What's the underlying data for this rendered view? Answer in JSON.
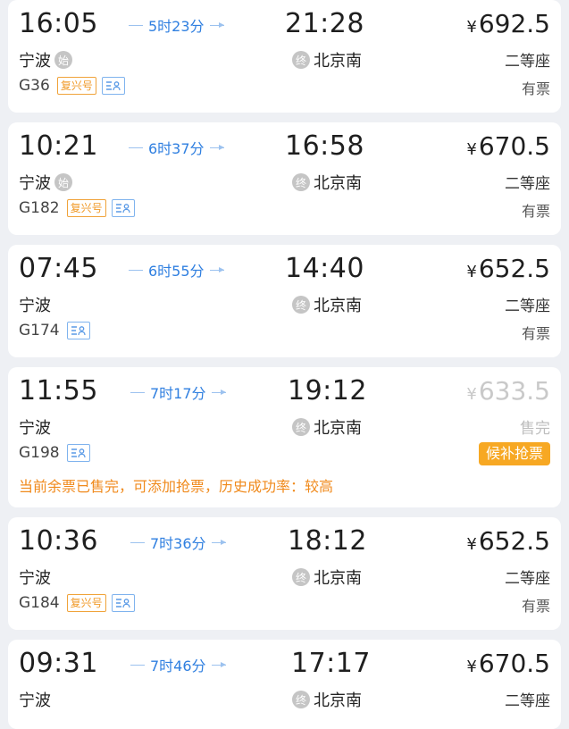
{
  "trains": [
    {
      "dep_time": "16:05",
      "arr_time": "21:28",
      "duration": "5时23分",
      "from": "宁波",
      "from_badge": "始",
      "to": "北京南",
      "to_badge": "终",
      "price": "692.5",
      "seat": "二等座",
      "train_no": "G36",
      "fuxing": "复兴号",
      "avail": "有票",
      "sold_out": false
    },
    {
      "dep_time": "10:21",
      "arr_time": "16:58",
      "duration": "6时37分",
      "from": "宁波",
      "from_badge": "始",
      "to": "北京南",
      "to_badge": "终",
      "price": "670.5",
      "seat": "二等座",
      "train_no": "G182",
      "fuxing": "复兴号",
      "avail": "有票",
      "sold_out": false
    },
    {
      "dep_time": "07:45",
      "arr_time": "14:40",
      "duration": "6时55分",
      "from": "宁波",
      "from_badge": "",
      "to": "北京南",
      "to_badge": "终",
      "price": "652.5",
      "seat": "二等座",
      "train_no": "G174",
      "fuxing": "",
      "avail": "有票",
      "sold_out": false
    },
    {
      "dep_time": "11:55",
      "arr_time": "19:12",
      "duration": "7时17分",
      "from": "宁波",
      "from_badge": "",
      "to": "北京南",
      "to_badge": "终",
      "price": "633.5",
      "seat": "售完",
      "train_no": "G198",
      "fuxing": "",
      "avail": "",
      "waitlist": "候补抢票",
      "note": "当前余票已售完，可添加抢票，历史成功率：较高",
      "sold_out": true
    },
    {
      "dep_time": "10:36",
      "arr_time": "18:12",
      "duration": "7时36分",
      "from": "宁波",
      "from_badge": "",
      "to": "北京南",
      "to_badge": "终",
      "price": "652.5",
      "seat": "二等座",
      "train_no": "G184",
      "fuxing": "复兴号",
      "avail": "有票",
      "sold_out": false
    },
    {
      "dep_time": "09:31",
      "arr_time": "17:17",
      "duration": "7时46分",
      "from": "宁波",
      "from_badge": "",
      "to": "北京南",
      "to_badge": "终",
      "price": "670.5",
      "seat": "二等座",
      "train_no": "",
      "fuxing": "",
      "avail": "",
      "sold_out": false
    }
  ],
  "currency_symbol": "¥",
  "colors": {
    "accent": "#2f7fe0",
    "orange": "#f7a823",
    "background": "#eef0f4"
  }
}
